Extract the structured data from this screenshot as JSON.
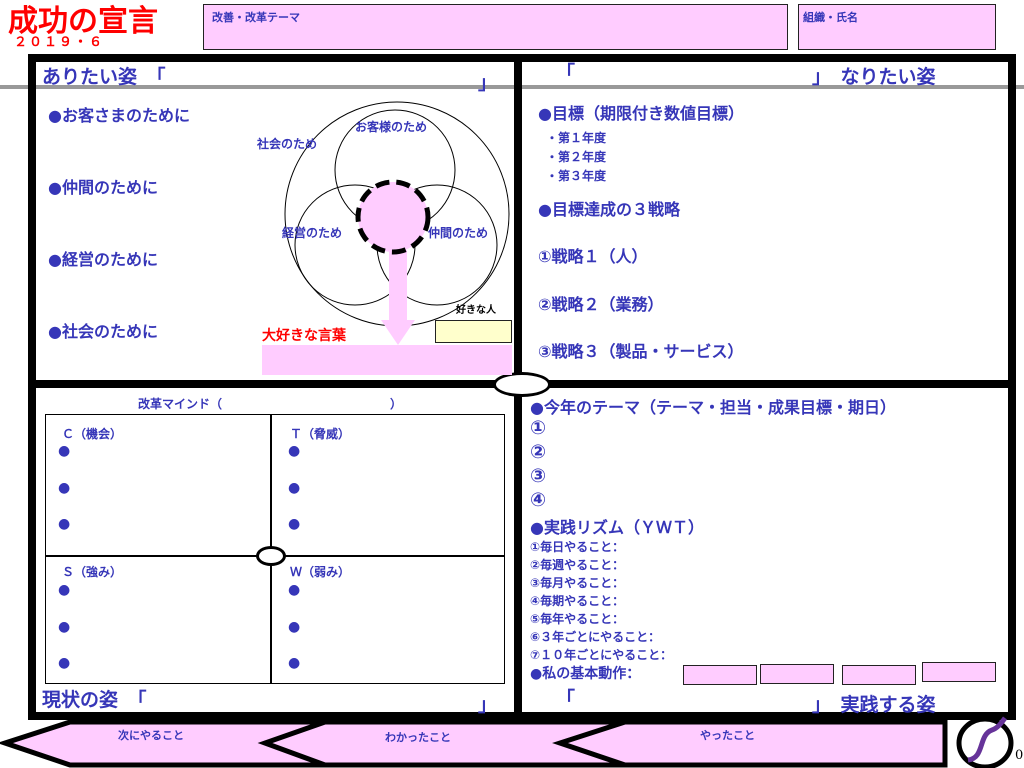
{
  "header": {
    "title": "成功の宣言",
    "date": "２０１９・６",
    "theme_label": "改善・改革テーマ",
    "org_label": "組織・氏名"
  },
  "ideal": {
    "title": "ありたい姿　「",
    "close": "」",
    "items": [
      "●お客さまのために",
      "●仲間のために",
      "●経営のために",
      "●社会のために"
    ],
    "venn": {
      "top": "お客様のため",
      "society": "社会のため",
      "mgmt": "経営のため",
      "peers": "仲間のため"
    },
    "favorite_person": "好きな人",
    "favorite_words": "大好きな言葉"
  },
  "goal": {
    "open": "「",
    "title": "」　なりたい姿",
    "target": "●目標（期限付き数値目標）",
    "years": [
      "・第１年度",
      "・第２年度",
      "・第３年度"
    ],
    "strategy_title": "●目標達成の３戦略",
    "strategies": [
      "①戦略１（人）",
      "②戦略２（業務）",
      "③戦略３（製品・サービス）"
    ]
  },
  "current": {
    "mind": "改革マインド（　　　　　　　　　　　　　　）",
    "c": "Ｃ（機会）",
    "t": "Ｔ（脅威）",
    "s": "Ｓ（強み）",
    "w": "Ｗ（弱み）",
    "bullet": "●",
    "title": "現状の姿　「",
    "close": "」"
  },
  "practice": {
    "theme": "●今年のテーマ（テーマ・担当・成果目標・期日）",
    "nums": [
      "①",
      "②",
      "③",
      "④"
    ],
    "rhythm": "●実践リズム（ＹＷＴ）",
    "rhythm_items": [
      "①毎日やること：",
      "②毎週やること：",
      "③毎月やること：",
      "④毎期やること：",
      "⑤毎年やること：",
      "⑥３年ごとにやること：",
      "⑦１０年ごとにやること："
    ],
    "basic": "●私の基本動作：",
    "open": "「",
    "title": "」　実践する姿"
  },
  "footer": {
    "next": "次にやること",
    "learned": "わかったこと",
    "done": "やったこと",
    "page": "0"
  },
  "colors": {
    "text": "#3636b8",
    "title": "#ff0000",
    "pink": "#ffccff",
    "yellow": "#ffffcc"
  }
}
